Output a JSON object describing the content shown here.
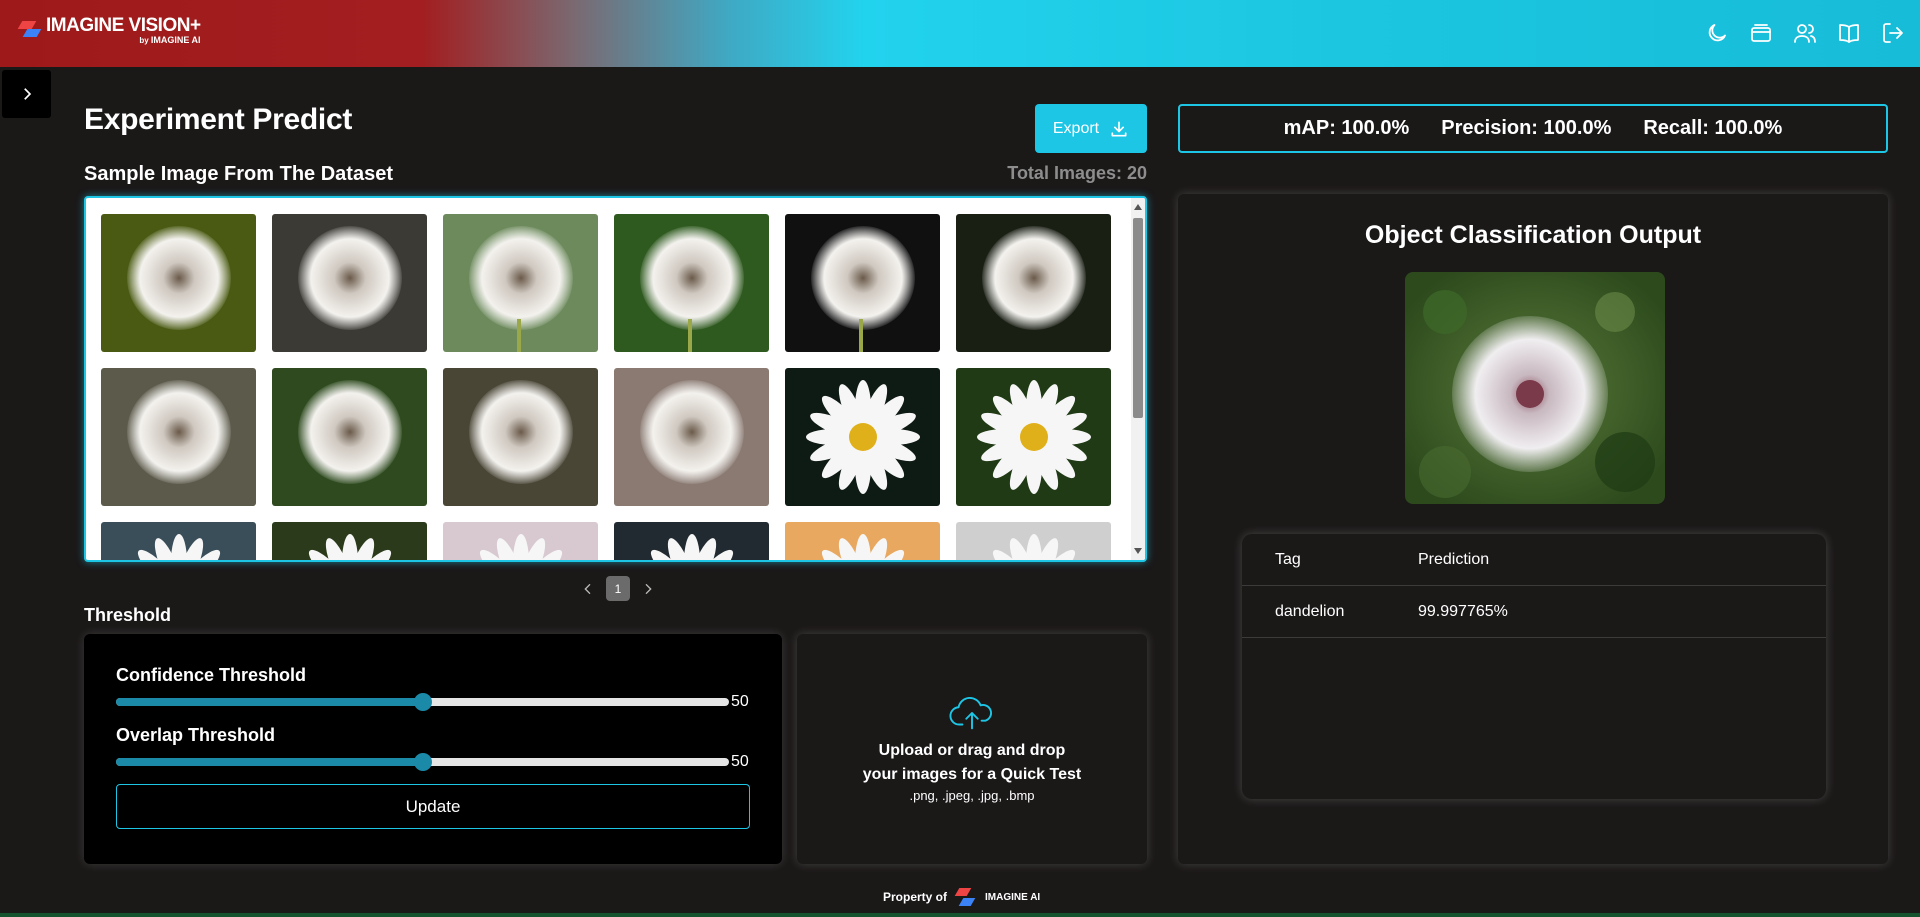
{
  "app": {
    "logo_main": "IMAGINE VISION+",
    "logo_by": "by",
    "logo_brand": "IMAGINE AI"
  },
  "header_icons": [
    "moon-icon",
    "layers-icon",
    "users-icon",
    "book-icon",
    "logout-icon"
  ],
  "page": {
    "title": "Experiment Predict",
    "export_label": "Export",
    "sample_label": "Sample Image From The Dataset",
    "total_images": "Total Images: 20"
  },
  "gallery": {
    "thumbnails": [
      {
        "kind": "dandelion",
        "bg": "#4a5a12"
      },
      {
        "kind": "dandelion",
        "bg": "#3b3a34"
      },
      {
        "kind": "dandelion",
        "bg": "#6d8a5c"
      },
      {
        "kind": "dandelion",
        "bg": "#2f5a1f"
      },
      {
        "kind": "dandelion",
        "bg": "#101010"
      },
      {
        "kind": "dandelion",
        "bg": "#1a1f14"
      },
      {
        "kind": "dandelion",
        "bg": "#5c5a4a"
      },
      {
        "kind": "dandelion",
        "bg": "#2e4a1e"
      },
      {
        "kind": "dandelion",
        "bg": "#4a4636"
      },
      {
        "kind": "dandelion",
        "bg": "#8a7a72"
      },
      {
        "kind": "daisy",
        "bg": "#0e1a14"
      },
      {
        "kind": "daisy",
        "bg": "#1f3a14"
      },
      {
        "kind": "daisy",
        "bg": "#3a4e5a"
      },
      {
        "kind": "daisy",
        "bg": "#2a3a1a"
      },
      {
        "kind": "daisy",
        "bg": "#d8c8d0"
      },
      {
        "kind": "daisy",
        "bg": "#202a30"
      },
      {
        "kind": "daisy",
        "bg": "#e8a860"
      },
      {
        "kind": "daisy",
        "bg": "#cfcfcf"
      }
    ],
    "page": "1"
  },
  "threshold": {
    "section_label": "Threshold",
    "confidence_label": "Confidence Threshold",
    "confidence_value": "50",
    "confidence_fraction": 0.5,
    "overlap_label": "Overlap Threshold",
    "overlap_value": "50",
    "overlap_fraction": 0.5,
    "update_label": "Update"
  },
  "upload": {
    "line1": "Upload or drag and drop",
    "line2": "your images for a Quick Test",
    "formats": ".png, .jpeg, .jpg, .bmp"
  },
  "metrics": {
    "map": "mAP: 100.0%",
    "precision": "Precision: 100.0%",
    "recall": "Recall: 100.0%"
  },
  "output": {
    "title": "Object Classification Output",
    "columns": [
      "Tag",
      "Prediction"
    ],
    "rows": [
      {
        "tag": "dandelion",
        "prediction": "99.997765%"
      }
    ]
  },
  "footer": {
    "property_of": "Property of",
    "brand": "IMAGINE AI"
  },
  "colors": {
    "accent": "#1ec6e6",
    "slider": "#1a8aa8",
    "background": "#1b1818"
  }
}
